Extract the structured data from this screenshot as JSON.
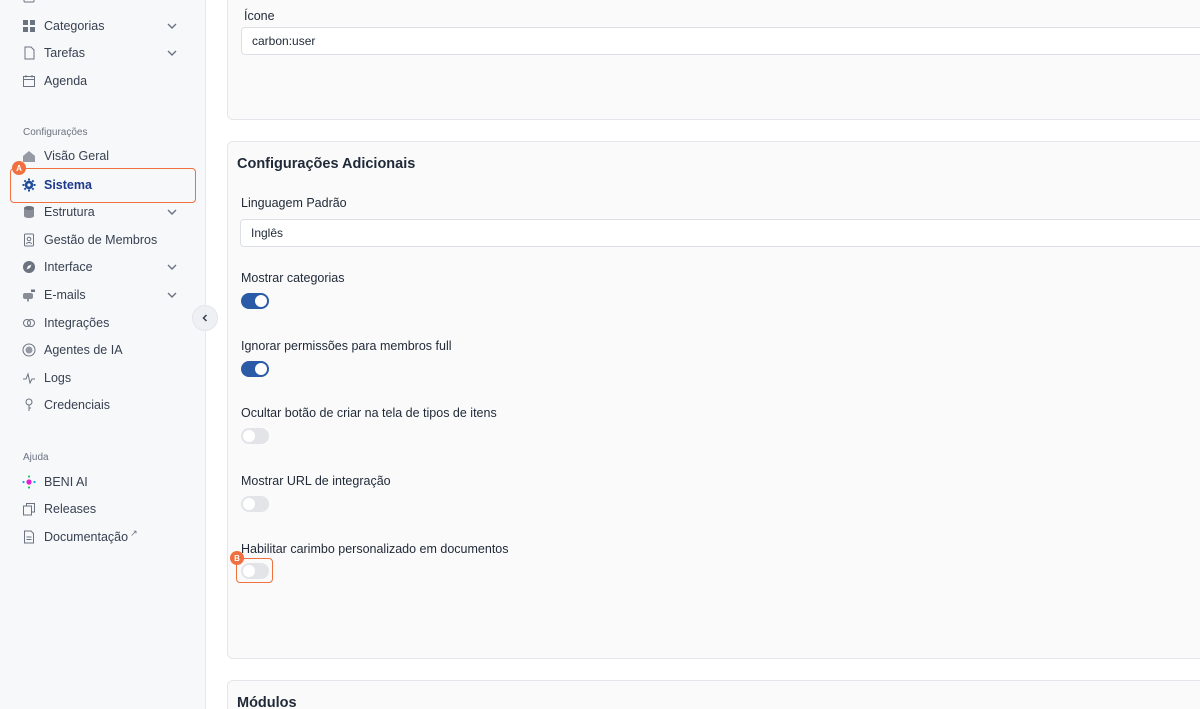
{
  "sidebar": {
    "top_items": [
      {
        "label": "Categorias",
        "icon": "grid-icon"
      },
      {
        "label": "Tarefas",
        "icon": "file-icon"
      },
      {
        "label": "Agenda",
        "icon": "calendar-icon"
      }
    ],
    "config_section": "Configurações",
    "config_items": [
      {
        "label": "Visão Geral",
        "icon": "house-icon"
      },
      {
        "label": "Sistema",
        "icon": "gear-icon"
      },
      {
        "label": "Estrutura",
        "icon": "database-icon"
      },
      {
        "label": "Gestão de Membros",
        "icon": "badge-icon"
      },
      {
        "label": "Interface",
        "icon": "compass-icon"
      },
      {
        "label": "E-mails",
        "icon": "mailbox-icon"
      },
      {
        "label": "Integrações",
        "icon": "link-icon"
      },
      {
        "label": "Agentes de IA",
        "icon": "chip-icon"
      },
      {
        "label": "Logs",
        "icon": "activity-icon"
      },
      {
        "label": "Credenciais",
        "icon": "key-icon"
      }
    ],
    "help_section": "Ajuda",
    "help_items": [
      {
        "label": "BENI AI",
        "icon": "sparkle-icon"
      },
      {
        "label": "Releases",
        "icon": "copy-icon"
      },
      {
        "label": "Documentação",
        "icon": "document-icon",
        "suffix": "↗"
      }
    ]
  },
  "annotations": {
    "a": "A",
    "b": "B"
  },
  "icon_panel": {
    "label": "Ícone",
    "value": "carbon:user"
  },
  "additional": {
    "title": "Configurações Adicionais",
    "language_label": "Linguagem Padrão",
    "language_value": "Inglês",
    "toggles": [
      {
        "label": "Mostrar categorias",
        "state": "on"
      },
      {
        "label": "Ignorar permissões para membros full",
        "state": "on"
      },
      {
        "label": "Ocultar botão de criar na tela de tipos de itens",
        "state": "off"
      },
      {
        "label": "Mostrar URL de integração",
        "state": "off"
      },
      {
        "label": "Habilitar carimbo personalizado em documentos",
        "state": "off"
      }
    ]
  },
  "modules": {
    "title": "Módulos"
  },
  "colors": {
    "accent": "#2b5aa7",
    "highlight": "#f0703f"
  }
}
